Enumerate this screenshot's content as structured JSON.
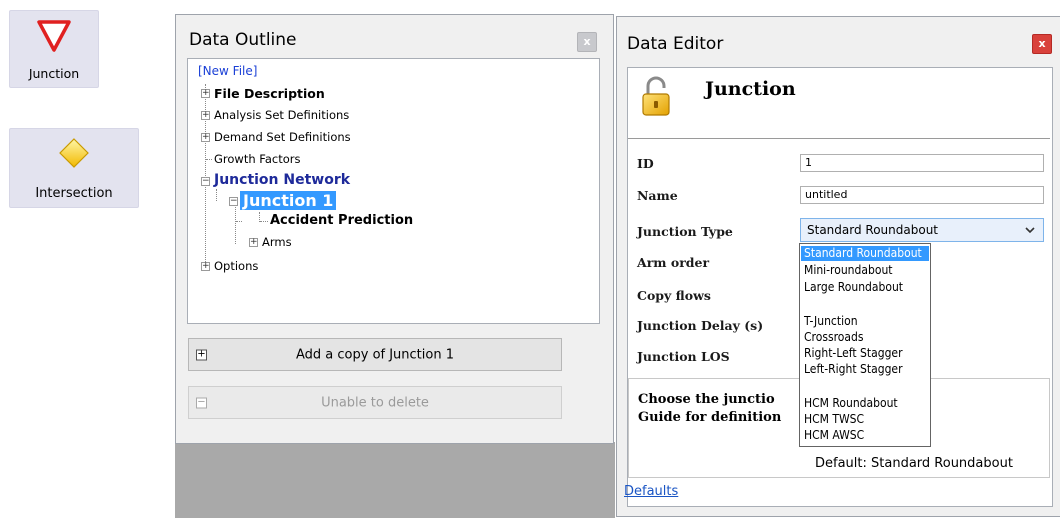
{
  "toolbar": {
    "junction": {
      "label": "Junction",
      "icon": "yield-triangle-icon",
      "color": "#e02020"
    },
    "intersection": {
      "label": "Intersection",
      "icon": "yellow-diamond-icon",
      "color": "#f5c400"
    }
  },
  "outline": {
    "title": "Data Outline",
    "close_glyph": "x",
    "tree": {
      "root": "[New File]",
      "file_description": "File Description",
      "analysis_sets": "Analysis Set Definitions",
      "demand_sets": "Demand Set Definitions",
      "growth_factors": "Growth Factors",
      "junction_network": "Junction Network",
      "junction_1": "Junction 1",
      "accident_prediction": "Accident Prediction",
      "arms": "Arms",
      "options": "Options"
    },
    "add_copy_label": "Add a copy of Junction 1",
    "delete_label": "Unable to delete",
    "plus_glyph": "+",
    "minus_glyph": "−"
  },
  "editor": {
    "title": "Data Editor",
    "close_glyph": "x",
    "heading": "Junction",
    "heading_icon": "padlock-open-icon",
    "fields": {
      "id_label": "ID",
      "id_value": "1",
      "name_label": "Name",
      "name_value": "untitled",
      "type_label": "Junction Type",
      "type_value": "Standard Roundabout",
      "arm_order_label": "Arm order",
      "copy_flows_label": "Copy flows",
      "delay_label": "Junction Delay (s)",
      "los_label": "Junction LOS"
    },
    "dropdown_options": [
      "Standard Roundabout",
      "Mini-roundabout",
      "Large Roundabout",
      "",
      "T-Junction",
      "Crossroads",
      "Right-Left Stagger",
      "Left-Right Stagger",
      "",
      "HCM Roundabout",
      "HCM TWSC",
      "HCM AWSC"
    ],
    "help_line1": "Choose the junctio",
    "help_line2": "Guide for definition",
    "default_text": "Default: Standard Roundabout",
    "defaults_link": "Defaults",
    "accent_color": "#3399ff"
  }
}
